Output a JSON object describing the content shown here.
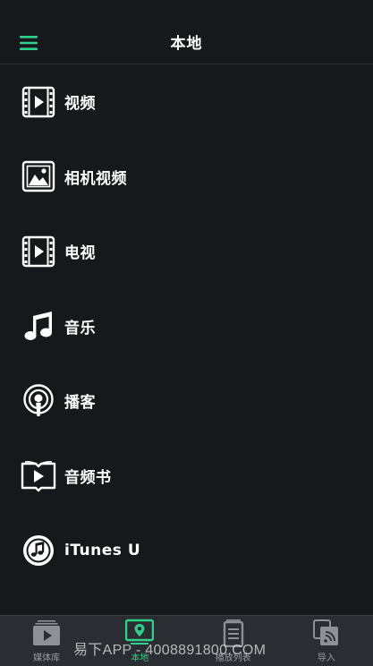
{
  "header": {
    "title": "本地",
    "menu_icon": "hamburger-menu-icon",
    "accent_color": "#2fd18a"
  },
  "list": {
    "items": [
      {
        "label": "视频",
        "icon": "film-icon"
      },
      {
        "label": "相机视频",
        "icon": "photo-icon"
      },
      {
        "label": "电视",
        "icon": "film-icon"
      },
      {
        "label": "音乐",
        "icon": "music-note-icon"
      },
      {
        "label": "播客",
        "icon": "podcast-icon"
      },
      {
        "label": "音频书",
        "icon": "audiobook-icon"
      },
      {
        "label": "iTunes U",
        "icon": "itunes-u-icon"
      }
    ]
  },
  "tabbar": {
    "tabs": [
      {
        "label": "媒体库",
        "icon": "media-library-icon",
        "active": false
      },
      {
        "label": "本地",
        "icon": "local-pin-icon",
        "active": true
      },
      {
        "label": "播放列表",
        "icon": "playlist-icon",
        "active": false
      },
      {
        "label": "导入",
        "icon": "import-icon",
        "active": false
      }
    ]
  },
  "watermark": "易下APP - 4008891800.COM"
}
